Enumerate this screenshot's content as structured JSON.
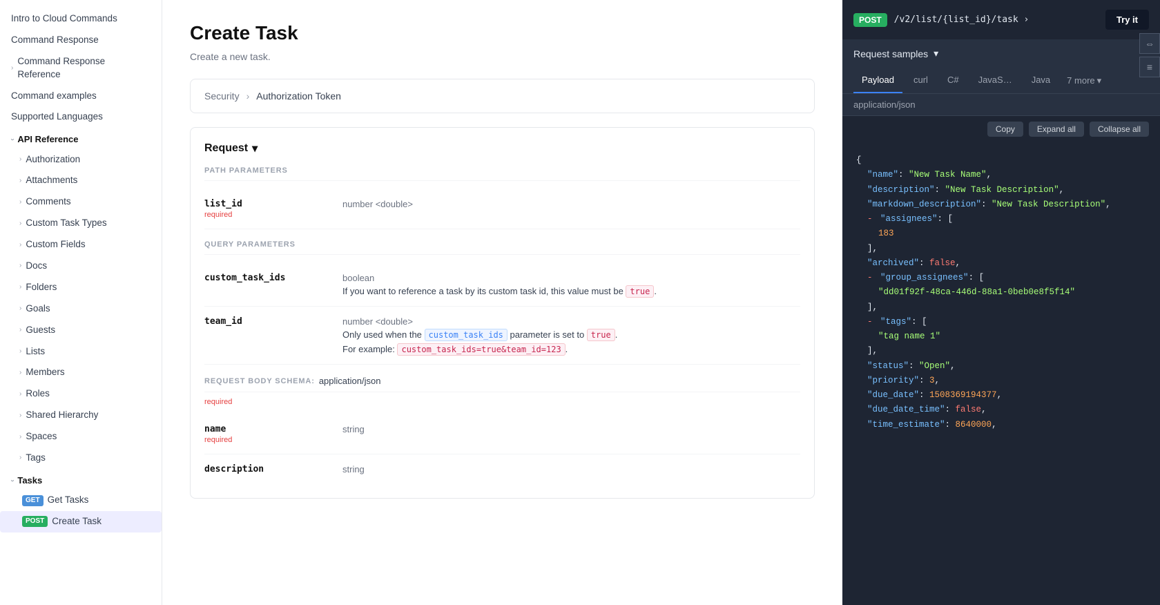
{
  "sidebar": {
    "items": [
      {
        "id": "intro",
        "label": "Intro to Cloud Commands",
        "indent": false,
        "chevron": false
      },
      {
        "id": "command-response",
        "label": "Command Response",
        "indent": false,
        "chevron": false
      },
      {
        "id": "command-response-ref",
        "label": "Command Response Reference",
        "indent": false,
        "chevron": true,
        "chevronDir": "right"
      },
      {
        "id": "command-examples",
        "label": "Command examples",
        "indent": false,
        "chevron": false
      },
      {
        "id": "supported-languages",
        "label": "Supported Languages",
        "indent": false,
        "chevron": false
      },
      {
        "id": "api-reference",
        "label": "API Reference",
        "indent": false,
        "chevron": true,
        "chevronDir": "down",
        "isSection": true
      },
      {
        "id": "authorization",
        "label": "Authorization",
        "indent": true,
        "chevron": true,
        "chevronDir": "right"
      },
      {
        "id": "attachments",
        "label": "Attachments",
        "indent": true,
        "chevron": true,
        "chevronDir": "right"
      },
      {
        "id": "comments",
        "label": "Comments",
        "indent": true,
        "chevron": true,
        "chevronDir": "right"
      },
      {
        "id": "custom-task-types",
        "label": "Custom Task Types",
        "indent": true,
        "chevron": true,
        "chevronDir": "right"
      },
      {
        "id": "custom-fields",
        "label": "Custom Fields",
        "indent": true,
        "chevron": true,
        "chevronDir": "right"
      },
      {
        "id": "docs",
        "label": "Docs",
        "indent": true,
        "chevron": true,
        "chevronDir": "right"
      },
      {
        "id": "folders",
        "label": "Folders",
        "indent": true,
        "chevron": true,
        "chevronDir": "right"
      },
      {
        "id": "goals",
        "label": "Goals",
        "indent": true,
        "chevron": true,
        "chevronDir": "right"
      },
      {
        "id": "guests",
        "label": "Guests",
        "indent": true,
        "chevron": true,
        "chevronDir": "right"
      },
      {
        "id": "lists",
        "label": "Lists",
        "indent": true,
        "chevron": true,
        "chevronDir": "right"
      },
      {
        "id": "members",
        "label": "Members",
        "indent": true,
        "chevron": true,
        "chevronDir": "right"
      },
      {
        "id": "roles",
        "label": "Roles",
        "indent": true,
        "chevron": true,
        "chevronDir": "right"
      },
      {
        "id": "shared-hierarchy",
        "label": "Shared Hierarchy",
        "indent": true,
        "chevron": true,
        "chevronDir": "right"
      },
      {
        "id": "spaces",
        "label": "Spaces",
        "indent": true,
        "chevron": true,
        "chevronDir": "right"
      },
      {
        "id": "tags",
        "label": "Tags",
        "indent": true,
        "chevron": true,
        "chevronDir": "right"
      },
      {
        "id": "tasks",
        "label": "Tasks",
        "indent": true,
        "chevron": true,
        "chevronDir": "down",
        "isSection": true
      },
      {
        "id": "get-tasks",
        "label": "Get Tasks",
        "indent": true,
        "badge": "GET",
        "isTaskItem": true
      },
      {
        "id": "create-task",
        "label": "Create Task",
        "indent": true,
        "badge": "POST",
        "isTaskItem": true,
        "active": true
      }
    ]
  },
  "main": {
    "title": "Create Task",
    "subtitle": "Create a new task.",
    "security": {
      "label": "Security",
      "arrow": "›",
      "value": "Authorization Token"
    },
    "request": {
      "label": "Request",
      "chevron": "▾",
      "pathParams": {
        "label": "PATH PARAMETERS",
        "items": [
          {
            "name": "list_id",
            "required": true,
            "type": "number <double>"
          }
        ]
      },
      "queryParams": {
        "label": "QUERY PARAMETERS",
        "items": [
          {
            "name": "custom_task_ids",
            "type": "boolean",
            "description": "If you want to reference a task by its custom task id, this value must be",
            "codeValue": "true",
            "descAfter": "."
          },
          {
            "name": "team_id",
            "type": "number <double>",
            "description": "Only used when the",
            "codeValue": "custom_task_ids",
            "descMid": "parameter is set to",
            "codeValue2": "true",
            "descAfter": ".",
            "example": "For example:",
            "exampleCode": "custom_task_ids=true&team_id=123",
            "exampleAfter": "."
          }
        ]
      },
      "bodySchema": {
        "label": "REQUEST BODY SCHEMA:",
        "value": "application/json",
        "required": true,
        "fields": [
          {
            "name": "name",
            "required": true,
            "type": "string"
          },
          {
            "name": "description",
            "required": false,
            "type": "string"
          }
        ]
      }
    }
  },
  "rightPanel": {
    "endpoint": {
      "method": "POST",
      "path": "/v2/list/{list_id}/task ›",
      "tryItLabel": "Try it"
    },
    "requestSamples": {
      "label": "Request samples",
      "chevron": "▾"
    },
    "tabs": [
      {
        "id": "payload",
        "label": "Payload",
        "active": true
      },
      {
        "id": "curl",
        "label": "curl"
      },
      {
        "id": "csharp",
        "label": "C#"
      },
      {
        "id": "javascript",
        "label": "JavaS…"
      },
      {
        "id": "java",
        "label": "Java"
      }
    ],
    "moreLabel": "7 more",
    "contentType": "application/json",
    "actions": {
      "copy": "Copy",
      "expandAll": "Expand all",
      "collapseAll": "Collapse all"
    },
    "codeLines": [
      {
        "indent": 0,
        "text": "{"
      },
      {
        "indent": 1,
        "key": "\"name\"",
        "value": "\"New Task Name\"",
        "valueType": "string",
        "comma": true
      },
      {
        "indent": 1,
        "key": "\"description\"",
        "value": "\"New Task Description\"",
        "valueType": "string",
        "comma": true
      },
      {
        "indent": 1,
        "key": "\"markdown_description\"",
        "value": "\"New Task Description\"",
        "valueType": "string",
        "comma": true
      },
      {
        "indent": 1,
        "collapse": true,
        "key": "\"assignees\"",
        "value": "[",
        "valueType": "bracket"
      },
      {
        "indent": 2,
        "value": "183",
        "valueType": "number"
      },
      {
        "indent": 1,
        "text": "],"
      },
      {
        "indent": 1,
        "key": "\"archived\"",
        "value": "false",
        "valueType": "bool",
        "comma": true
      },
      {
        "indent": 1,
        "collapse": true,
        "key": "\"group_assignees\"",
        "value": "[",
        "valueType": "bracket"
      },
      {
        "indent": 2,
        "value": "\"dd01f92f-48ca-446d-88a1-0beb0e8f5f14\"",
        "valueType": "string"
      },
      {
        "indent": 1,
        "text": "],"
      },
      {
        "indent": 1,
        "collapse": true,
        "key": "\"tags\"",
        "value": "[",
        "valueType": "bracket"
      },
      {
        "indent": 2,
        "value": "\"tag name 1\"",
        "valueType": "string"
      },
      {
        "indent": 1,
        "text": "],"
      },
      {
        "indent": 1,
        "key": "\"status\"",
        "value": "\"Open\"",
        "valueType": "string",
        "comma": true
      },
      {
        "indent": 1,
        "key": "\"priority\"",
        "value": "3",
        "valueType": "number",
        "comma": true
      },
      {
        "indent": 1,
        "key": "\"due_date\"",
        "value": "1508369194377",
        "valueType": "number",
        "comma": true
      },
      {
        "indent": 1,
        "key": "\"due_date_time\"",
        "value": "false",
        "valueType": "bool",
        "comma": true
      },
      {
        "indent": 1,
        "key": "\"time_estimate\"",
        "value": "8640000",
        "valueType": "number",
        "comma": true
      }
    ]
  }
}
